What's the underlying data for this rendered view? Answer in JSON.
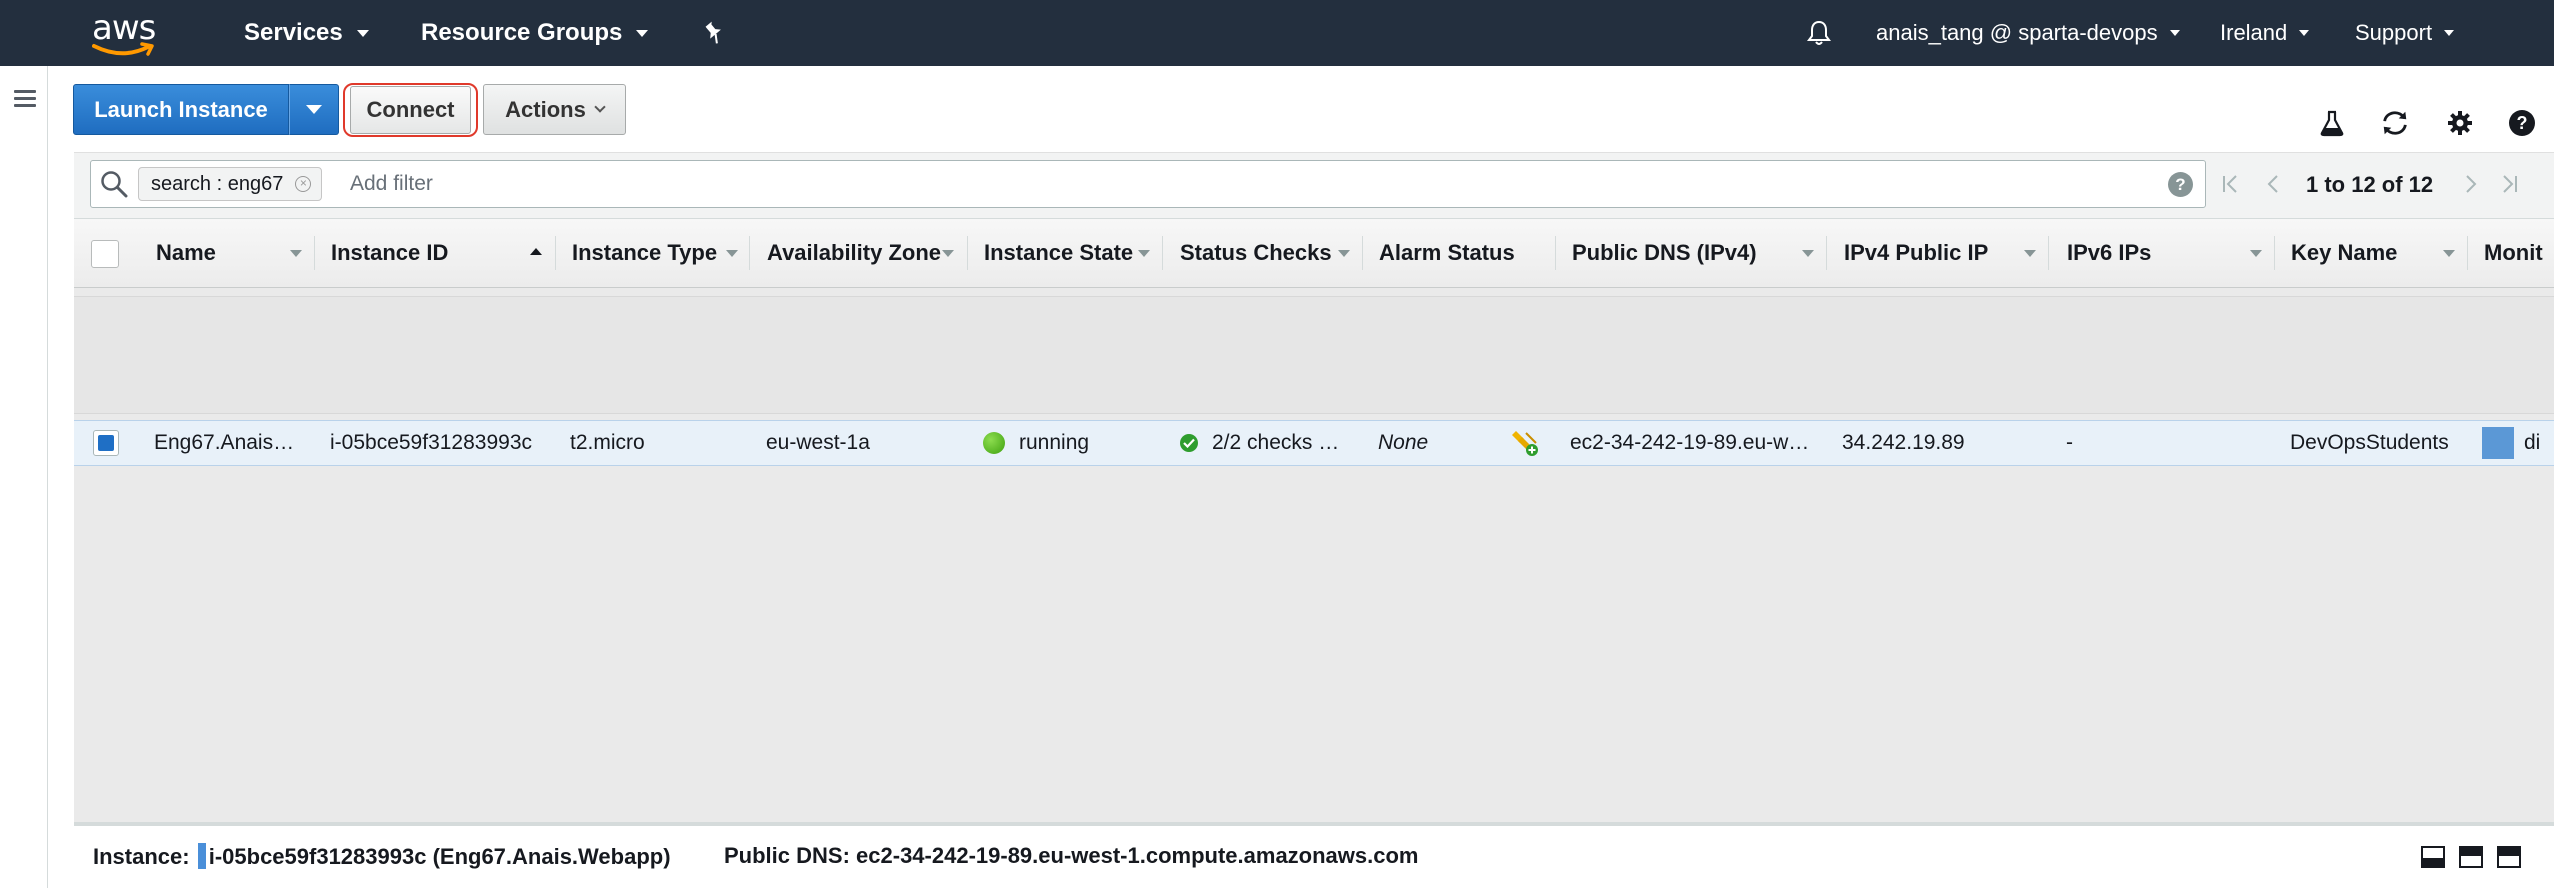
{
  "nav": {
    "logo_text": "aws",
    "services": "Services",
    "resource_groups": "Resource Groups",
    "user": "anais_tang @ sparta-devops",
    "region": "Ireland",
    "support": "Support"
  },
  "toolbar": {
    "launch_label": "Launch Instance",
    "connect_label": "Connect",
    "actions_label": "Actions"
  },
  "filter": {
    "chip_text": "search : eng67",
    "placeholder": "Add filter",
    "pager_text": "1 to 12 of 12"
  },
  "columns": [
    "Name",
    "Instance ID",
    "Instance Type",
    "Availability Zone",
    "Instance State",
    "Status Checks",
    "Alarm Status",
    "Public DNS (IPv4)",
    "IPv4 Public IP",
    "IPv6 IPs",
    "Key Name",
    "Monit"
  ],
  "rows": [
    {
      "name": "Eng67.Anais…",
      "instance_id": "i-05bce59f31283993c",
      "instance_type": "t2.micro",
      "availability_zone": "eu-west-1a",
      "instance_state": "running",
      "status_checks": "2/2 checks …",
      "alarm_status": "None",
      "public_dns": "ec2-34-242-19-89.eu-w…",
      "ipv4_public_ip": "34.242.19.89",
      "ipv6_ips": "-",
      "key_name": "DevOpsStudents",
      "monitoring": "di"
    }
  ],
  "details": {
    "instance_label": "Instance:",
    "instance_value": "i-05bce59f31283993c (Eng67.Anais.Webapp)",
    "dns_label": "Public DNS:",
    "dns_value": "ec2-34-242-19-89.eu-west-1.compute.amazonaws.com"
  },
  "colors": {
    "nav_bg": "#232f3e",
    "primary": "#1f6fc5",
    "running": "#3ea10f",
    "highlight_ring": "#e0392b",
    "selected_row": "#e8f1f9"
  },
  "icons": [
    "bell-icon",
    "pin-icon",
    "flask-icon",
    "refresh-icon",
    "gear-icon",
    "help-icon",
    "search-icon",
    "alarm-add-icon"
  ]
}
